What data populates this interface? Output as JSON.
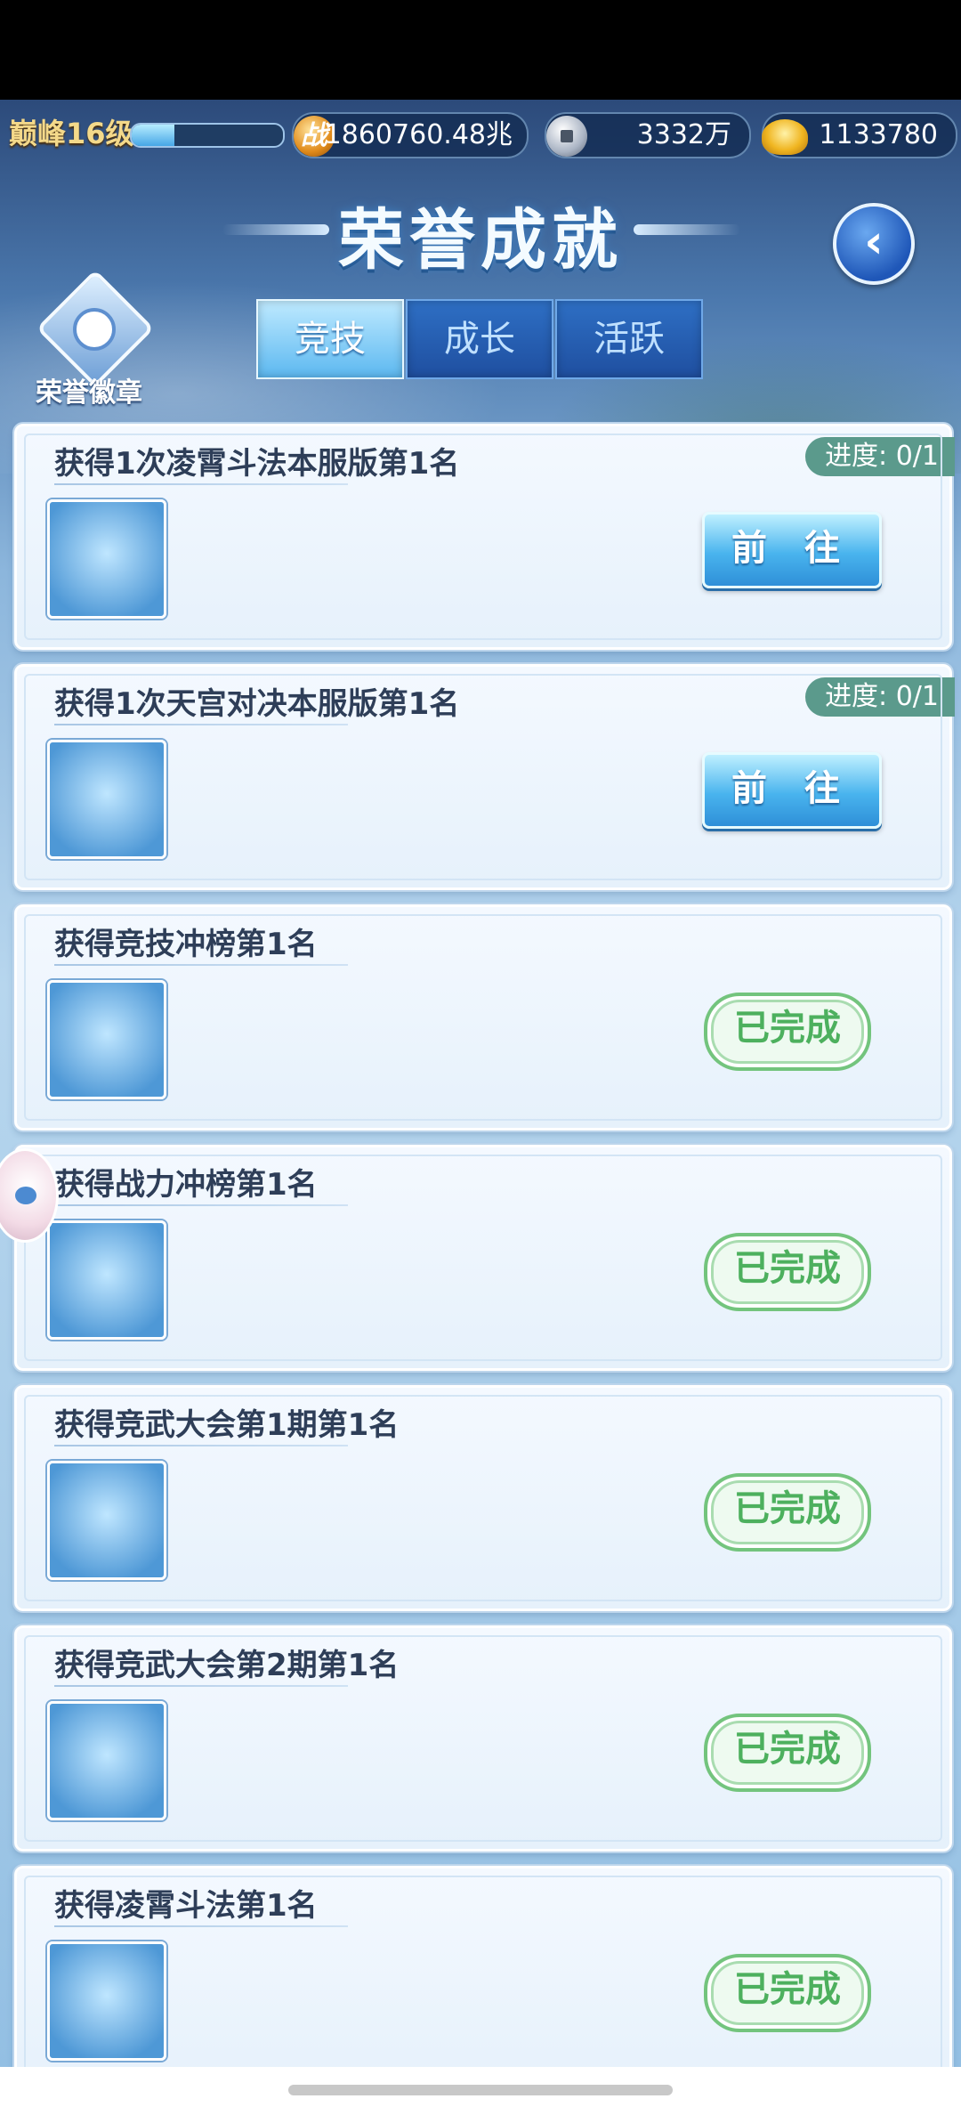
{
  "status": {
    "level_label": "巅峰16级",
    "level_progress": 0.28,
    "combat_power": "1860760.48兆",
    "combat_icon_label": "战",
    "silver": "3332万",
    "gold": "1133780"
  },
  "header": {
    "title": "荣誉成就",
    "back_icon": "chevron-left-icon"
  },
  "honor_badge": {
    "label": "荣誉徽章"
  },
  "tabs": [
    {
      "label": "竞技",
      "active": true
    },
    {
      "label": "成长",
      "active": false
    },
    {
      "label": "活跃",
      "active": false
    }
  ],
  "achievements": [
    {
      "title": "获得1次凌霄斗法本服版第1名",
      "progress": "进度: 0/1",
      "action": "前 往",
      "completed": false,
      "icon": "crown-orange-icon"
    },
    {
      "title": "获得1次天宫对决本服版第1名",
      "progress": "进度: 0/1",
      "action": "前 往",
      "completed": false,
      "icon": "flame-wings-icon"
    },
    {
      "title": "获得竞技冲榜第1名",
      "action": "已完成",
      "completed": true,
      "icon": "star-sword-icon"
    },
    {
      "title": "获得战力冲榜第1名",
      "action": "已完成",
      "completed": true,
      "icon": "golden-horns-icon"
    },
    {
      "title": "获得竞武大会第1期第1名",
      "action": "已完成",
      "completed": true,
      "icon": "red-banner-icon"
    },
    {
      "title": "获得竞武大会第2期第1名",
      "action": "已完成",
      "completed": true,
      "icon": "purple-wings-icon"
    },
    {
      "title": "获得凌霄斗法第1名",
      "action": "已完成",
      "completed": true,
      "icon": "red-orb-frame-icon"
    }
  ]
}
